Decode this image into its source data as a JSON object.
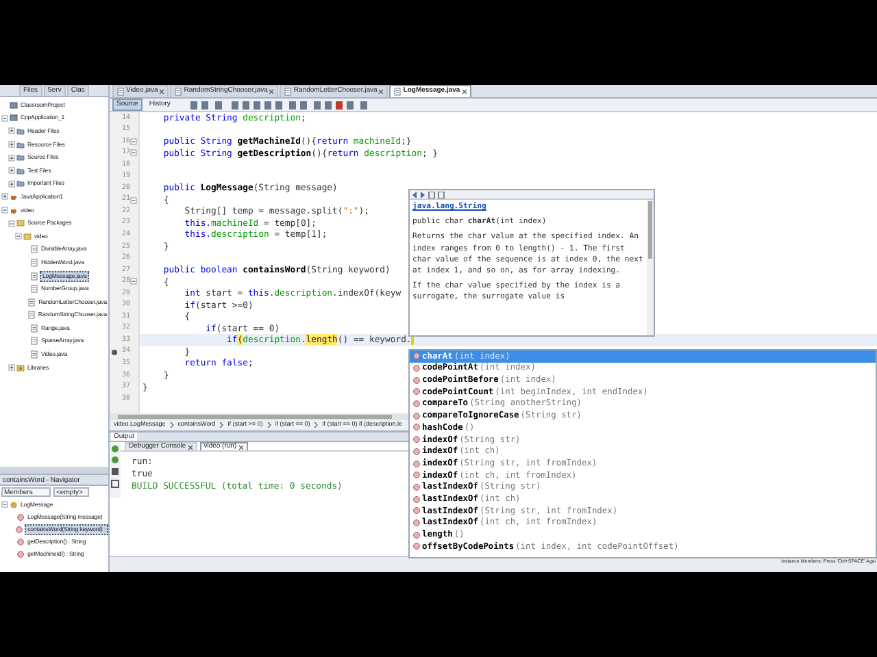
{
  "explorer": {
    "tabs": [
      {
        "label": "Files",
        "selected": false
      },
      {
        "label": "Serv",
        "selected": false
      },
      {
        "label": "Clas",
        "selected": false
      }
    ],
    "tree": [
      {
        "label": "ClassroomProject",
        "kind": "project"
      },
      {
        "label": "CppApplication_1",
        "kind": "project",
        "expanded": true,
        "children": [
          {
            "label": "Header Files",
            "kind": "folder",
            "expanded": false
          },
          {
            "label": "Resource Files",
            "kind": "folder",
            "expanded": false
          },
          {
            "label": "Source Files",
            "kind": "folder",
            "expanded": false
          },
          {
            "label": "Test Files",
            "kind": "folder",
            "expanded": false
          },
          {
            "label": "Important Files",
            "kind": "folder",
            "expanded": false
          }
        ]
      },
      {
        "label": "JavaApplication1",
        "kind": "java",
        "expanded": false
      },
      {
        "label": "video",
        "kind": "java",
        "expanded": true,
        "children": [
          {
            "label": "Source Packages",
            "kind": "package",
            "expanded": true,
            "children": [
              {
                "label": "video",
                "kind": "package",
                "expanded": true,
                "children": [
                  {
                    "label": "DivisibleArray.java",
                    "kind": "file",
                    "selected": false
                  },
                  {
                    "label": "HiddenWord.java",
                    "kind": "file",
                    "selected": false
                  },
                  {
                    "label": "LogMessage.java",
                    "kind": "file",
                    "selected": true
                  },
                  {
                    "label": "NumberGroup.java",
                    "kind": "file",
                    "selected": false
                  },
                  {
                    "label": "RandomLetterChooser.java",
                    "kind": "file",
                    "selected": false
                  },
                  {
                    "label": "RandomStringChooser.java",
                    "kind": "file",
                    "selected": false
                  },
                  {
                    "label": "Range.java",
                    "kind": "file",
                    "selected": false
                  },
                  {
                    "label": "SparseArray.java",
                    "kind": "file",
                    "selected": false
                  },
                  {
                    "label": "Video.java",
                    "kind": "file",
                    "selected": false
                  }
                ]
              }
            ]
          },
          {
            "label": "Libraries",
            "kind": "library",
            "expanded": false
          }
        ]
      }
    ]
  },
  "navigator": {
    "title": "containsWord - Navigator",
    "filter": "Members",
    "scope": "<empty>",
    "items": [
      {
        "label": "LogMessage",
        "kind": "class",
        "expanded": true,
        "children": [
          {
            "label": "LogMessage(String message)",
            "kind": "method",
            "selected": false
          },
          {
            "label": "containsWord(String keyword) :",
            "kind": "method",
            "selected": true
          },
          {
            "label": "getDescription() : String",
            "kind": "method",
            "selected": false
          },
          {
            "label": "getMachineId() : String",
            "kind": "method",
            "selected": false
          }
        ]
      }
    ]
  },
  "editor": {
    "tabs": [
      {
        "label": "Video.java",
        "selected": false
      },
      {
        "label": "RandomStringChooser.java",
        "selected": false
      },
      {
        "label": "RandomLetterChooser.java",
        "selected": false
      },
      {
        "label": "LogMessage.java",
        "selected": true
      }
    ],
    "views": [
      {
        "label": "Source",
        "selected": true
      },
      {
        "label": "History",
        "selected": false
      }
    ],
    "lines": [
      {
        "n": "14",
        "s": [
          {
            "kind": "keyword",
            "text": "    private String "
          },
          {
            "kind": "field",
            "text": "description"
          },
          {
            "kind": "plain",
            "text": ";"
          }
        ]
      },
      {
        "n": "15"
      },
      {
        "n": "16",
        "fold": true,
        "s": [
          {
            "kind": "keyword",
            "text": "    public String "
          },
          {
            "kind": "method",
            "text": "getMachineId"
          },
          {
            "kind": "plain",
            "text": "(){"
          },
          {
            "kind": "keyword",
            "text": "return "
          },
          {
            "kind": "field",
            "text": "machineId"
          },
          {
            "kind": "plain",
            "text": ";}"
          }
        ]
      },
      {
        "n": "17",
        "fold": true,
        "s": [
          {
            "kind": "keyword",
            "text": "    public String "
          },
          {
            "kind": "method",
            "text": "getDescription"
          },
          {
            "kind": "plain",
            "text": "(){"
          },
          {
            "kind": "keyword",
            "text": "return "
          },
          {
            "kind": "field",
            "text": "description"
          },
          {
            "kind": "plain",
            "text": "; }"
          }
        ]
      },
      {
        "n": "18"
      },
      {
        "n": "19"
      },
      {
        "n": "20",
        "s": [
          {
            "kind": "keyword",
            "text": "    public "
          },
          {
            "kind": "method",
            "text": "LogMessage"
          },
          {
            "kind": "plain",
            "text": "(String message)"
          }
        ]
      },
      {
        "n": "21",
        "fold": true,
        "s": [
          {
            "kind": "plain",
            "text": "    {"
          }
        ]
      },
      {
        "n": "22",
        "s": [
          {
            "kind": "plain",
            "text": "        String[] temp = message.split("
          },
          {
            "kind": "string",
            "text": "\":\""
          },
          {
            "kind": "plain",
            "text": ");"
          }
        ]
      },
      {
        "n": "23",
        "s": [
          {
            "kind": "keyword",
            "text": "        this."
          },
          {
            "kind": "field",
            "text": "machineId"
          },
          {
            "kind": "plain",
            "text": " = temp[0];"
          }
        ]
      },
      {
        "n": "24",
        "s": [
          {
            "kind": "keyword",
            "text": "        this."
          },
          {
            "kind": "field",
            "text": "description"
          },
          {
            "kind": "plain",
            "text": " = temp[1];"
          }
        ]
      },
      {
        "n": "25",
        "s": [
          {
            "kind": "plain",
            "text": "    }"
          }
        ]
      },
      {
        "n": "26"
      },
      {
        "n": "27",
        "s": [
          {
            "kind": "keyword",
            "text": "    public boolean "
          },
          {
            "kind": "method",
            "text": "containsWord"
          },
          {
            "kind": "plain",
            "text": "(String keyword)"
          }
        ]
      },
      {
        "n": "28",
        "fold": true,
        "s": [
          {
            "kind": "plain",
            "text": "    {"
          }
        ]
      },
      {
        "n": "29",
        "s": [
          {
            "kind": "keyword",
            "text": "        int "
          },
          {
            "kind": "plain",
            "text": "start = "
          },
          {
            "kind": "keyword",
            "text": "this"
          },
          {
            "kind": "plain",
            "text": "."
          },
          {
            "kind": "field",
            "text": "description"
          },
          {
            "kind": "plain",
            "text": ".indexOf(keyw"
          }
        ]
      },
      {
        "n": "30",
        "s": [
          {
            "kind": "keyword",
            "text": "        if"
          },
          {
            "kind": "plain",
            "text": "(start >=0)"
          }
        ]
      },
      {
        "n": "31",
        "s": [
          {
            "kind": "plain",
            "text": "        {"
          }
        ]
      },
      {
        "n": "32",
        "s": [
          {
            "kind": "keyword",
            "text": "            if"
          },
          {
            "kind": "plain",
            "text": "(start == 0)"
          }
        ]
      },
      {
        "n": "33",
        "current": true,
        "s": [
          {
            "kind": "keyword",
            "text": "                if"
          },
          {
            "kind": "match",
            "text": "("
          },
          {
            "kind": "field",
            "text": "description"
          },
          {
            "kind": "plain",
            "text": "."
          },
          {
            "kind": "match",
            "text": "length"
          },
          {
            "kind": "plain",
            "text": "() == keyword."
          }
        ]
      },
      {
        "n": "34",
        "marker": true,
        "s": [
          {
            "kind": "plain",
            "text": "        }"
          }
        ]
      },
      {
        "n": "35",
        "s": [
          {
            "kind": "keyword",
            "text": "        return false"
          },
          {
            "kind": "plain",
            "text": ";"
          }
        ]
      },
      {
        "n": "36",
        "s": [
          {
            "kind": "plain",
            "text": "    }"
          }
        ]
      },
      {
        "n": "37",
        "s": [
          {
            "kind": "plain",
            "text": "}"
          }
        ]
      },
      {
        "n": "38"
      }
    ],
    "breadcrumbs": [
      "video.LogMessage",
      "containsWord",
      "if (start >= 0)",
      "if (start == 0)",
      "if (start == 0) if (description.le"
    ]
  },
  "javadoc": {
    "package": "java.lang.String",
    "signature": "public char **charAt**(int index)",
    "paragraphs": [
      "Returns the char value at the specified index. An index ranges from 0 to length() - 1. The first char value of the sequence is at index 0, the next at index 1, and so on, as for array indexing.",
      "If the char value specified by the index is a surrogate, the surrogate value is"
    ]
  },
  "completion": [
    {
      "name": "charAt",
      "params": "(int index)",
      "selected": true
    },
    {
      "name": "codePointAt",
      "params": "(int index)",
      "selected": false
    },
    {
      "name": "codePointBefore",
      "params": "(int index)",
      "selected": false
    },
    {
      "name": "codePointCount",
      "params": "(int beginIndex, int endIndex)",
      "selected": false
    },
    {
      "name": "compareTo",
      "params": "(String anotherString)",
      "selected": false
    },
    {
      "name": "compareToIgnoreCase",
      "params": "(String str)",
      "selected": false
    },
    {
      "name": "hashCode",
      "params": "()",
      "selected": false
    },
    {
      "name": "indexOf",
      "params": "(String str)",
      "selected": false
    },
    {
      "name": "indexOf",
      "params": "(int ch)",
      "selected": false
    },
    {
      "name": "indexOf",
      "params": "(String str, int fromIndex)",
      "selected": false
    },
    {
      "name": "indexOf",
      "params": "(int ch, int fromIndex)",
      "selected": false
    },
    {
      "name": "lastIndexOf",
      "params": "(String str)",
      "selected": false
    },
    {
      "name": "lastIndexOf",
      "params": "(int ch)",
      "selected": false
    },
    {
      "name": "lastIndexOf",
      "params": "(String str, int fromIndex)",
      "selected": false
    },
    {
      "name": "lastIndexOf",
      "params": "(int ch, int fromIndex)",
      "selected": false
    },
    {
      "name": "length",
      "params": "()",
      "selected": false
    },
    {
      "name": "offsetByCodePoints",
      "params": "(int index, int codePointOffset)",
      "selected": false
    }
  ],
  "output": {
    "title": "Output",
    "tabs": [
      {
        "label": "Debugger Console",
        "selected": false
      },
      {
        "label": "video (run)",
        "selected": true
      }
    ],
    "lines": [
      {
        "text": "run:",
        "kind": "plain"
      },
      {
        "text": "true",
        "kind": "plain"
      },
      {
        "text": "BUILD SUCCESSFUL (total time: 0 seconds)",
        "kind": "success"
      }
    ]
  },
  "status_bar": "Instance Members; Press 'Ctrl+SPACE' Agai"
}
